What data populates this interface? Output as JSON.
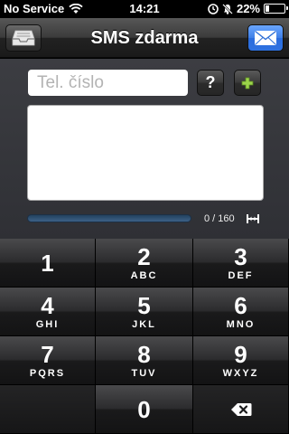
{
  "statusbar": {
    "carrier": "No Service",
    "time": "14:21",
    "battery_percent": "22%",
    "battery_level": 0.22,
    "icons": [
      "wifi-icon",
      "alarm-icon",
      "silent-icon"
    ]
  },
  "navbar": {
    "title": "SMS zdarma",
    "left_icon": "tray-icon",
    "right_icon": "envelope-icon"
  },
  "compose": {
    "phone_placeholder": "Tel. číslo",
    "phone_value": "",
    "help_label": "?",
    "add_icon": "plus-icon",
    "message_value": "",
    "counter": "0 / 160",
    "progress": 0.0,
    "counter_icon": "resize-icon"
  },
  "keypad": {
    "keys": [
      {
        "num": "1",
        "letters": ""
      },
      {
        "num": "2",
        "letters": "ABC"
      },
      {
        "num": "3",
        "letters": "DEF"
      },
      {
        "num": "4",
        "letters": "GHI"
      },
      {
        "num": "5",
        "letters": "JKL"
      },
      {
        "num": "6",
        "letters": "MNO"
      },
      {
        "num": "7",
        "letters": "PQRS"
      },
      {
        "num": "8",
        "letters": "TUV"
      },
      {
        "num": "9",
        "letters": "WXYZ"
      },
      {
        "num": "",
        "letters": ""
      },
      {
        "num": "0",
        "letters": ""
      },
      {
        "num": "",
        "letters": ""
      }
    ],
    "delete_icon": "backspace-icon"
  },
  "colors": {
    "accent_blue": "#2f72e0",
    "plus_green": "#9bd44a",
    "progress_track": "#2d4f74"
  }
}
